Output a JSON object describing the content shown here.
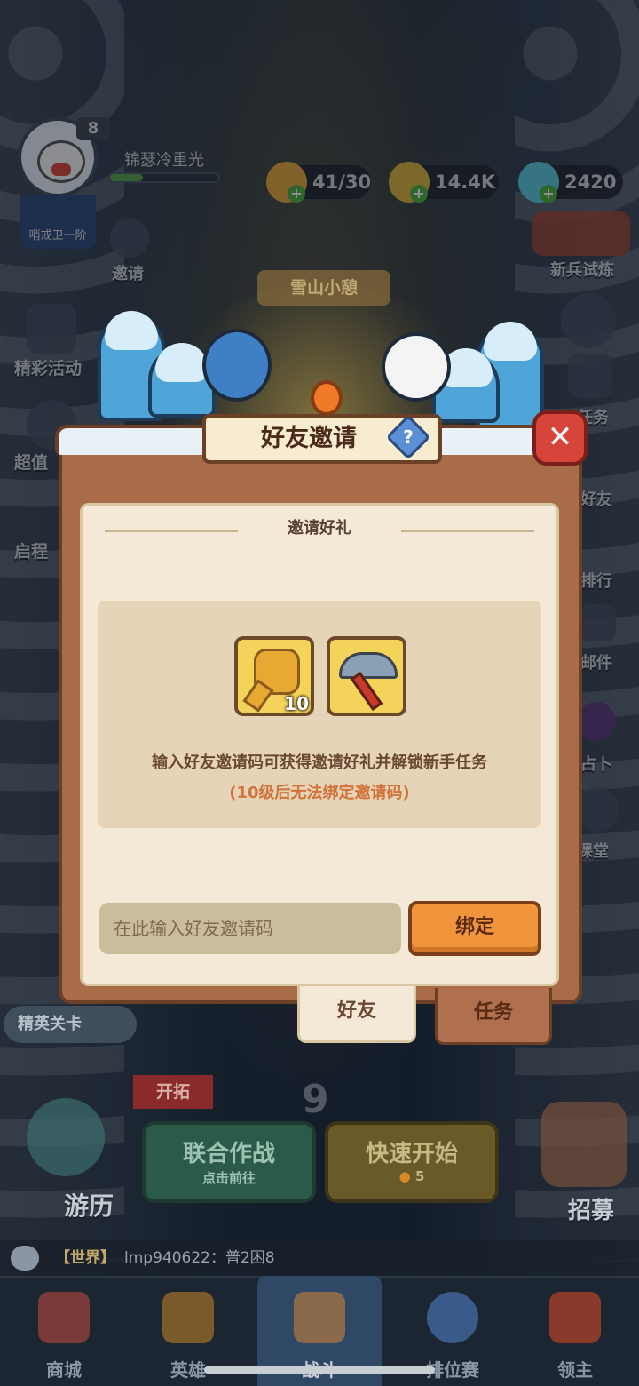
{
  "player": {
    "level": "8",
    "name": "锦瑟冷重光",
    "rank": "哨戒卫一阶",
    "xp_fraction": 0.3
  },
  "resources": [
    {
      "name": "stamina",
      "value": "41/30",
      "icon": "flame-icon",
      "color": "#e3a43a"
    },
    {
      "name": "gold",
      "value": "14.4K",
      "icon": "coin-icon",
      "color": "#d8b13a"
    },
    {
      "name": "crystal",
      "value": "2420",
      "icon": "crystal-icon",
      "color": "#5cc7d8"
    }
  ],
  "side_left": {
    "invite": "邀请",
    "events": "精彩活动",
    "super": "超值",
    "journey": "启程"
  },
  "side_right": {
    "trial": "新兵试炼",
    "task": "任务",
    "friend": "好友",
    "rank": "排行",
    "mail": "邮件",
    "divination": "占卜",
    "classroom": "课堂"
  },
  "scene": {
    "sign": "雪山小憩"
  },
  "dialog": {
    "title": "好友邀请",
    "help_glyph": "?",
    "close_glyph": "✕",
    "section_title": "邀请好礼",
    "rewards": [
      {
        "name": "gold-key",
        "icon": "key-icon",
        "count": "10"
      },
      {
        "name": "pickaxe",
        "icon": "pickaxe-icon",
        "count": ""
      }
    ],
    "info_line1": "输入好友邀请码可获得邀请好礼并解锁新手任务",
    "info_line2": "(10级后无法绑定邀请码)",
    "input_placeholder": "在此输入好友邀请码",
    "input_value": "",
    "bind_label": "绑定",
    "tabs": [
      {
        "label": "好友",
        "active": true
      },
      {
        "label": "任务",
        "active": false
      }
    ]
  },
  "lower_hud": {
    "elite_card": "精英关卡",
    "expand": "开拓",
    "stage_number": "9",
    "coop_title": "联合作战",
    "coop_sub": "点击前往",
    "quick_title": "快速开始",
    "quick_cost": "5",
    "adventure": "游历",
    "recruit": "招募"
  },
  "chat": {
    "channel": "【世界】",
    "message": "lmp940622：普2困8"
  },
  "nav": [
    {
      "label": "商城",
      "icon": "shop-icon"
    },
    {
      "label": "英雄",
      "icon": "hero-card-icon"
    },
    {
      "label": "战斗",
      "icon": "crossed-swords-icon",
      "active": true
    },
    {
      "label": "排位赛",
      "icon": "ranked-shield-icon"
    },
    {
      "label": "领主",
      "icon": "lord-banner-icon"
    }
  ]
}
